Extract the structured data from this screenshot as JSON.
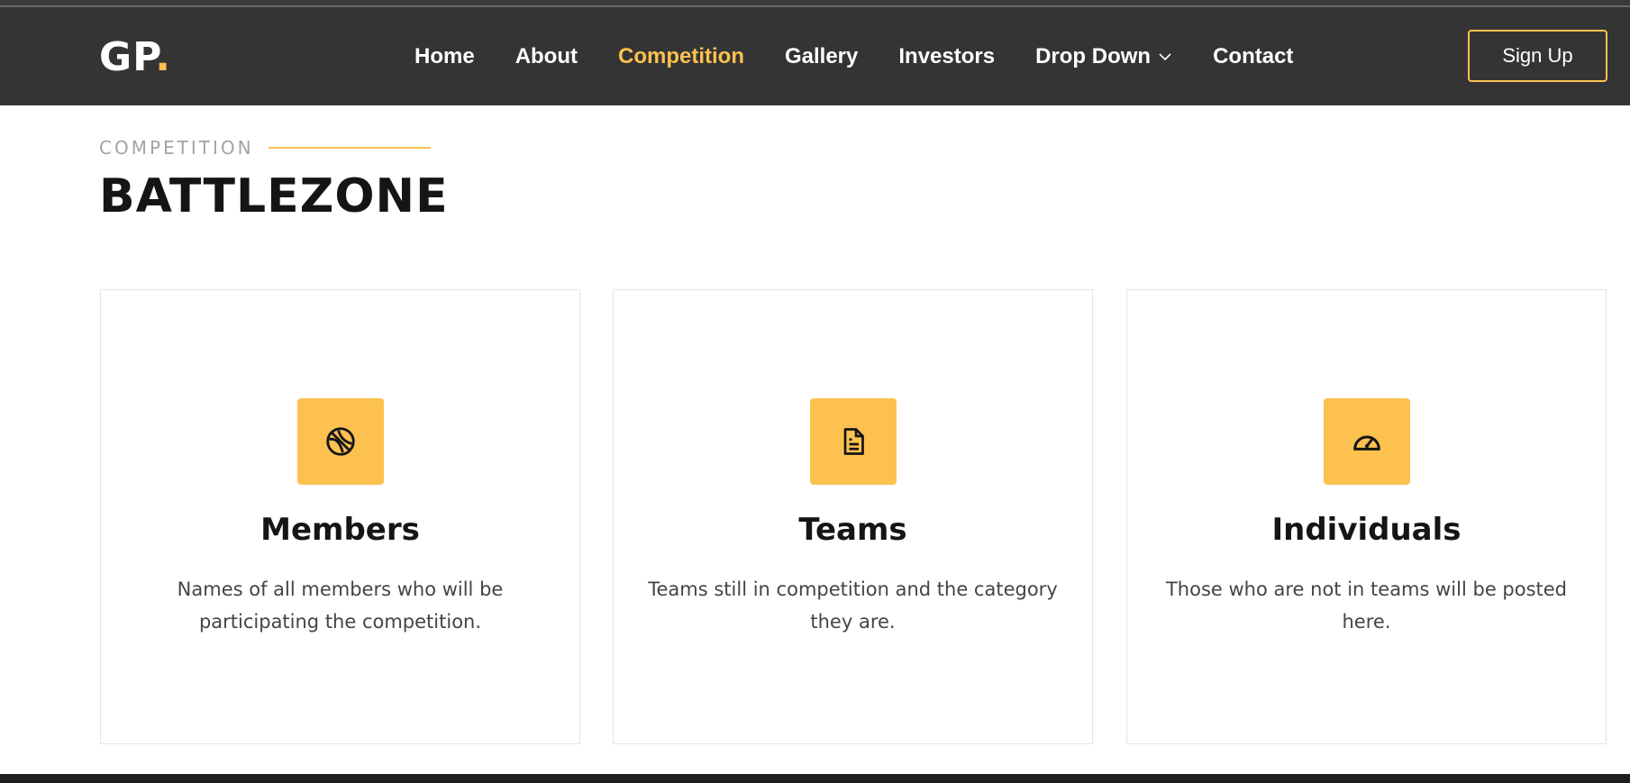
{
  "header": {
    "logo_text": "GP",
    "logo_dot": ".",
    "nav": [
      {
        "label": "Home",
        "active": false
      },
      {
        "label": "About",
        "active": false
      },
      {
        "label": "Competition",
        "active": true
      },
      {
        "label": "Gallery",
        "active": false
      },
      {
        "label": "Investors",
        "active": false
      },
      {
        "label": "Drop Down",
        "active": false,
        "has_dropdown": true
      },
      {
        "label": "Contact",
        "active": false
      }
    ],
    "signup_label": "Sign Up"
  },
  "section": {
    "label": "COMPETITION",
    "title": "BATTLEZONE"
  },
  "cards": [
    {
      "icon": "basketball-icon",
      "title": "Members",
      "text": "Names of all members who will be participating the competition."
    },
    {
      "icon": "document-icon",
      "title": "Teams",
      "text": "Teams still in competition and the category they are."
    },
    {
      "icon": "speedometer-icon",
      "title": "Individuals",
      "text": "Those who are not in teams will be posted here."
    }
  ],
  "colors": {
    "accent": "#fdc150",
    "header_bg": "#343434",
    "heading": "#151515",
    "body_text": "#444444"
  }
}
